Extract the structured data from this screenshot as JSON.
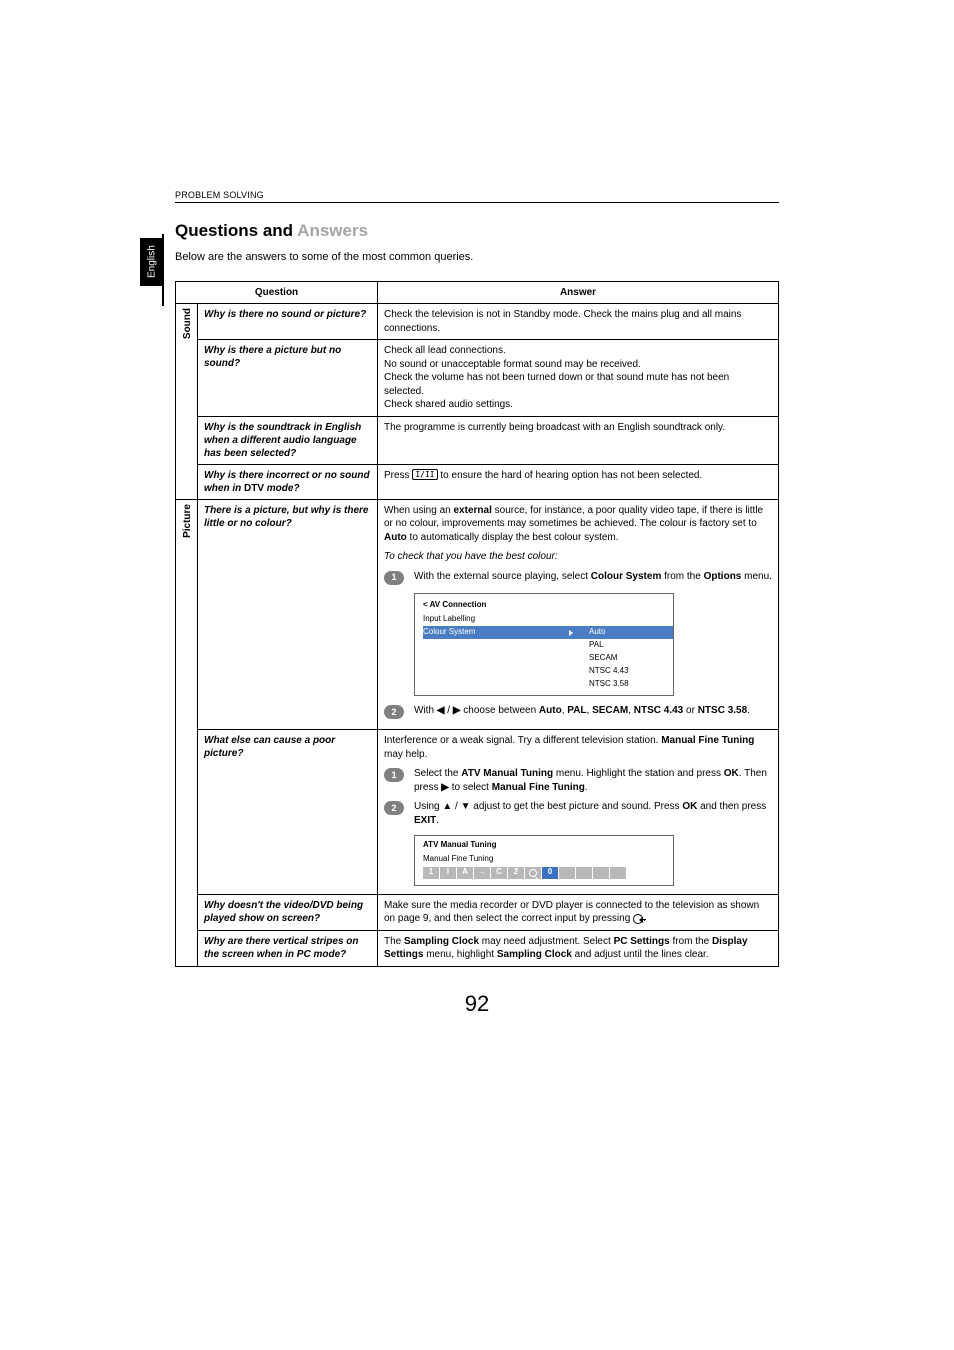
{
  "sectionHeader": "PROBLEM SOLVING",
  "langTab": "English",
  "titleDark": "Questions and ",
  "titleMuted": "Answers",
  "intro": "Below are the answers to some of the most common queries.",
  "headers": {
    "q": "Question",
    "a": "Answer"
  },
  "cat": {
    "sound": "Sound",
    "picture": "Picture"
  },
  "rows": {
    "r1": {
      "q": "Why is there no sound or picture?",
      "a": "Check the television is not in Standby mode. Check the mains plug and all mains connections."
    },
    "r2": {
      "q": "Why is there a picture but no sound?",
      "a1": "Check all lead connections.",
      "a2": "No sound or unacceptable format sound may be received.",
      "a3": "Check the volume has not been turned down or that sound mute has not been selected.",
      "a4": "Check shared audio settings."
    },
    "r3": {
      "q": "Why is the soundtrack in English when a different audio language has been selected?",
      "a": "The programme is currently being broadcast with an English soundtrack only."
    },
    "r4": {
      "q1": "Why is there incorrect or no sound when in ",
      "q2": "DTV",
      "q3": " mode?",
      "a1": "Press ",
      "a2": " to ensure the hard of hearing option has not been selected."
    },
    "r5": {
      "q": "There is a picture, but why is there little or no colour?",
      "a1a": "When using an ",
      "a1b": "external",
      "a1c": " source, for instance, a poor quality video tape, if there is little or no colour, improvements may sometimes be achieved. The colour is factory set to ",
      "a1d": "Auto",
      "a1e": " to automatically display the best colour system.",
      "a2": "To check that you have the best colour:",
      "s1a": "With the external source playing, select ",
      "s1b": "Colour System",
      "s1c": " from the ",
      "s1d": "Options",
      "s1e": " menu.",
      "menuTitle": "< AV Connection",
      "menuRow1": "Input Labelling",
      "menuRow2": "Colour System",
      "opts": {
        "auto": "Auto",
        "pal": "PAL",
        "secam": "SECAM",
        "n443": "NTSC 4.43",
        "n358": "NTSC 3.58"
      },
      "s2a": "With ",
      "s2b": " / ",
      "s2c": " choose between ",
      "s2d": "Auto",
      "s2e": ", ",
      "s2f": "PAL",
      "s2g": ", ",
      "s2h": "SECAM",
      "s2i": ", ",
      "s2j": "NTSC 4.43",
      "s2k": " or ",
      "s2l": "NTSC 3.58",
      "s2m": "."
    },
    "r6": {
      "q": "What else can cause a poor picture?",
      "a1a": "Interference or a weak signal. Try a different television station. ",
      "a1b": "Manual Fine Tuning",
      "a1c": " may help.",
      "s1a": "Select the ",
      "s1b": "ATV Manual Tuning",
      "s1c": " menu. Highlight the station and press ",
      "s1d": "OK",
      "s1e": ". Then press ",
      "s1f": " to select ",
      "s1g": "Manual Fine Tuning",
      "s1h": ".",
      "s2a": "Using ",
      "s2b": " / ",
      "s2c": " adjust to get the best picture and sound. Press ",
      "s2d": "OK",
      "s2e": " and then press ",
      "s2f": "EXIT",
      "s2g": ".",
      "boxTitle": "ATV Manual Tuning",
      "boxSub": "Manual Fine Tuning",
      "segs": [
        "1",
        "I",
        "A",
        "",
        "C",
        "2",
        "",
        "0",
        "",
        "",
        "",
        ""
      ]
    },
    "r7": {
      "q": "Why doesn't the video/DVD being played show on screen?",
      "a1": "Make sure the media recorder or DVD player is connected to the television as shown on page 9, and then select the correct input by pressing ",
      "a2": "."
    },
    "r8": {
      "q": "Why are there vertical stripes on the screen when in PC mode?",
      "a1": "The ",
      "a2": "Sampling Clock",
      "a3": " may need adjustment. Select ",
      "a4": "PC Settings",
      "a5": " from the ",
      "a6": "Display Settings",
      "a7": " menu, highlight ",
      "a8": "Sampling Clock",
      "a9": " and adjust until the lines clear."
    }
  },
  "arrows": {
    "left": "◀",
    "right": "▶",
    "up": "▲",
    "down": "▼"
  },
  "subtitleIcon": "I/II",
  "pageNum": "92"
}
